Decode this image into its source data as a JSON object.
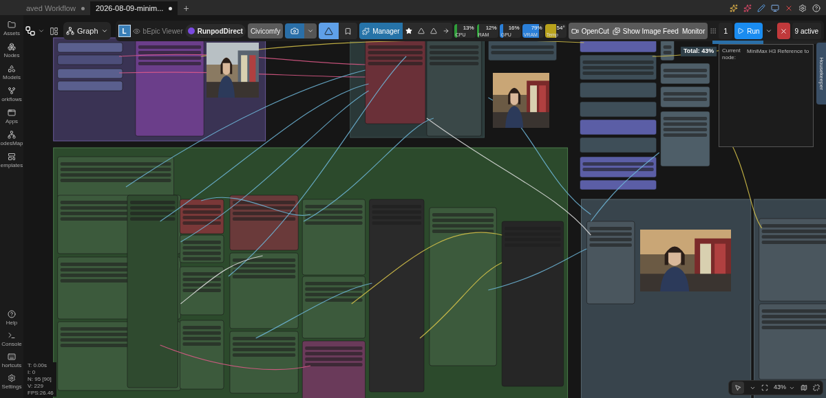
{
  "tabs": [
    {
      "label": "aved Workflow",
      "selected": false,
      "modified": true
    },
    {
      "label": "2026-08-09-minim...",
      "selected": true,
      "modified": true
    }
  ],
  "new_tab": "+",
  "toolbar": {
    "graph": "Graph",
    "viewer_badge": "L",
    "viewer": "bEpic Viewer",
    "runpod": "RunpodDirect",
    "civicomfy": "Civicomfy",
    "manager": "Manager",
    "monitors": [
      {
        "label": "CPU",
        "reading": "13%",
        "level": 0.13,
        "color": "#2f9e3a"
      },
      {
        "label": "RAM",
        "reading": "12%",
        "level": 0.12,
        "color": "#2f9e3a"
      },
      {
        "label": "GPU",
        "reading": "16%",
        "level": 0.16,
        "color": "#2a7fd8"
      },
      {
        "label": "VRAM",
        "reading": "79%",
        "level": 0.79,
        "color": "#2a7fd8"
      },
      {
        "label": "Temp",
        "reading": "54°",
        "level": 0.54,
        "color": "#b8a21c"
      }
    ],
    "opencut": "OpenCut",
    "image_feed": "Show Image Feed",
    "monitor": "Monitor",
    "queue_count": "1",
    "run": "Run",
    "active": "9 active"
  },
  "sidebar": {
    "items": [
      "Assets",
      "Nodes",
      "Models",
      "orkflows",
      "Apps",
      "odesMap",
      "emplates"
    ],
    "bottom_items": [
      "Help",
      "Console",
      "hortcuts",
      "Settings"
    ]
  },
  "stats": [
    "T: 0.00s",
    "I: 0",
    "N: 95 [90]",
    "V: 229",
    "FPS:26.46"
  ],
  "progress": {
    "total": "Total: 43%",
    "level": 0.43,
    "current_label": "Current node:",
    "current_node": "MiniMax H3 Reference to"
  },
  "side_panel": "Housekeeper",
  "zoom": "43%"
}
